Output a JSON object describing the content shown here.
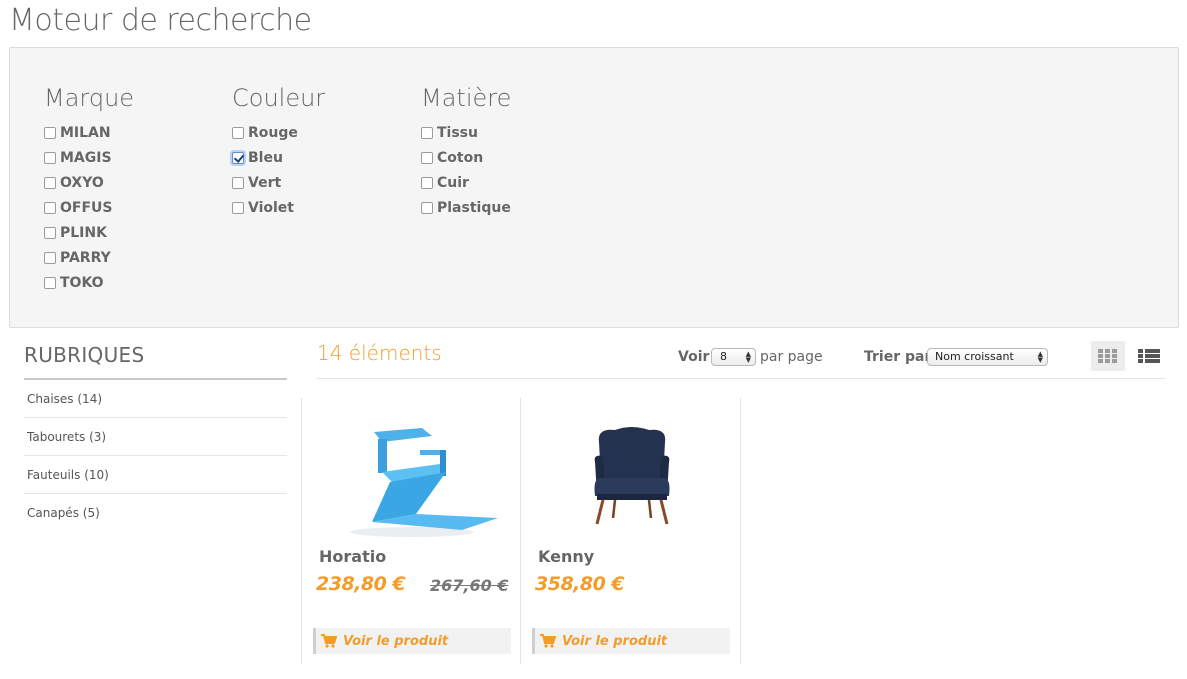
{
  "page": {
    "title": "Moteur de recherche"
  },
  "filters": {
    "marque": {
      "title": "Marque",
      "options": [
        {
          "label": "MILAN",
          "checked": false
        },
        {
          "label": "MAGIS",
          "checked": false
        },
        {
          "label": "OXYO",
          "checked": false
        },
        {
          "label": "OFFUS",
          "checked": false
        },
        {
          "label": "PLINK",
          "checked": false
        },
        {
          "label": "PARRY",
          "checked": false
        },
        {
          "label": "TOKO",
          "checked": false
        }
      ]
    },
    "couleur": {
      "title": "Couleur",
      "options": [
        {
          "label": "Rouge",
          "checked": false
        },
        {
          "label": "Bleu",
          "checked": true
        },
        {
          "label": "Vert",
          "checked": false
        },
        {
          "label": "Violet",
          "checked": false
        }
      ]
    },
    "matiere": {
      "title": "Matière",
      "options": [
        {
          "label": "Tissu",
          "checked": false
        },
        {
          "label": "Coton",
          "checked": false
        },
        {
          "label": "Cuir",
          "checked": false
        },
        {
          "label": "Plastique",
          "checked": false
        }
      ]
    }
  },
  "sidebar": {
    "title": "RUBRIQUES",
    "items": [
      "Chaises (14)",
      "Tabourets (3)",
      "Fauteuils (10)",
      "Canapés (5)"
    ]
  },
  "results": {
    "count": "14 éléments",
    "voir_label": "Voir",
    "per_page_value": "8",
    "par_page_label": "par page",
    "trier_label": "Trier par",
    "sort_value": "Nom croissant",
    "grid_icon": "grid-view-icon",
    "list_icon": "list-view-icon"
  },
  "products": [
    {
      "name": "Horatio",
      "price": "238,80 €",
      "old_price": "267,60 €",
      "cta": "Voir le produit",
      "image": "blue-zigzag-chair"
    },
    {
      "name": "Kenny",
      "price": "358,80 €",
      "old_price": "",
      "cta": "Voir le produit",
      "image": "navy-armchair"
    }
  ],
  "colors": {
    "accent": "#f39c2a",
    "text": "#666666",
    "panel_bg": "#f5f5f5"
  }
}
